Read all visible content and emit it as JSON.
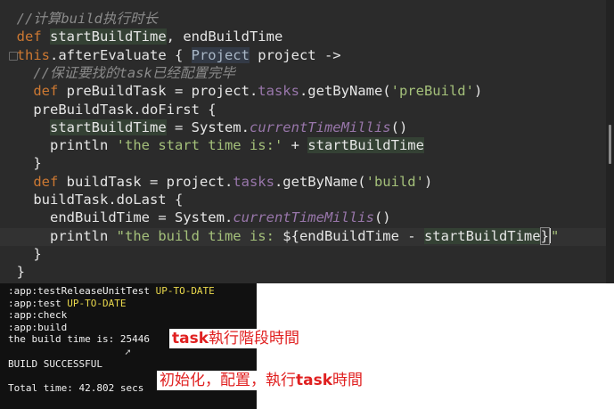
{
  "editor": {
    "lines": [
      {
        "indent": "  ",
        "parts": [
          {
            "t": "//计算build执行时长",
            "c": "cm"
          }
        ]
      },
      {
        "indent": "  ",
        "parts": [
          {
            "t": "def ",
            "c": "kw"
          },
          {
            "t": "startBuildTime",
            "c": "var-hl"
          },
          {
            "t": ", endBuildTime",
            "c": ""
          }
        ]
      },
      {
        "indent": "  ",
        "parts": [
          {
            "t": "this",
            "c": "kw"
          },
          {
            "t": ".afterEvaluate { ",
            "c": ""
          },
          {
            "t": "Project",
            "c": "ty"
          },
          {
            "t": " project ->",
            "c": ""
          }
        ]
      },
      {
        "indent": "    ",
        "parts": [
          {
            "t": "//保证要找的task已经配置完毕",
            "c": "cm"
          }
        ]
      },
      {
        "indent": "    ",
        "parts": [
          {
            "t": "def ",
            "c": "kw"
          },
          {
            "t": "preBuildTask = project.",
            "c": ""
          },
          {
            "t": "tasks",
            "c": "prop"
          },
          {
            "t": ".getByName(",
            "c": ""
          },
          {
            "t": "'preBuild'",
            "c": "str"
          },
          {
            "t": ")",
            "c": ""
          }
        ]
      },
      {
        "indent": "    ",
        "parts": [
          {
            "t": "preBuildTask.doFirst {",
            "c": ""
          }
        ]
      },
      {
        "indent": "      ",
        "parts": [
          {
            "t": "startBuildTime",
            "c": "var-hl"
          },
          {
            "t": " = System.",
            "c": ""
          },
          {
            "t": "currentTimeMillis",
            "c": "stat"
          },
          {
            "t": "()",
            "c": ""
          }
        ]
      },
      {
        "indent": "      ",
        "parts": [
          {
            "t": "println ",
            "c": ""
          },
          {
            "t": "'the start time is:'",
            "c": "str"
          },
          {
            "t": " + ",
            "c": ""
          },
          {
            "t": "startBuildTime",
            "c": "var-hl"
          }
        ]
      },
      {
        "indent": "    ",
        "parts": [
          {
            "t": "}",
            "c": ""
          }
        ]
      },
      {
        "indent": "    ",
        "parts": [
          {
            "t": "def ",
            "c": "kw"
          },
          {
            "t": "buildTask = project.",
            "c": ""
          },
          {
            "t": "tasks",
            "c": "prop"
          },
          {
            "t": ".getByName(",
            "c": ""
          },
          {
            "t": "'build'",
            "c": "str"
          },
          {
            "t": ")",
            "c": ""
          }
        ]
      },
      {
        "indent": "    ",
        "parts": [
          {
            "t": "buildTask.doLast {",
            "c": ""
          }
        ]
      },
      {
        "indent": "      ",
        "parts": [
          {
            "t": "endBuildTime = System.",
            "c": ""
          },
          {
            "t": "currentTimeMillis",
            "c": "stat"
          },
          {
            "t": "()",
            "c": ""
          }
        ]
      },
      {
        "indent": "      ",
        "parts": [
          {
            "t": "println ",
            "c": ""
          },
          {
            "t": "\"the build time is: ",
            "c": "str"
          },
          {
            "t": "${",
            "c": ""
          },
          {
            "t": "endBuildTime - ",
            "c": ""
          },
          {
            "t": "startBuildTime",
            "c": "var-hl"
          },
          {
            "t": "}",
            "c": "brace-hl"
          },
          {
            "t": "\"",
            "c": "str"
          }
        ]
      },
      {
        "indent": "    ",
        "parts": [
          {
            "t": "}",
            "c": ""
          }
        ]
      },
      {
        "indent": "  ",
        "parts": [
          {
            "t": "}",
            "c": ""
          }
        ]
      }
    ]
  },
  "terminal": {
    "lines": [
      {
        "text": ":app:testReleaseUnitTest ",
        "status": "UP-TO-DATE"
      },
      {
        "text": ":app:test ",
        "status": "UP-TO-DATE"
      },
      {
        "text": ":app:check",
        "status": ""
      },
      {
        "text": ":app:build",
        "status": ""
      },
      {
        "text": "the build time is: 25446",
        "status": ""
      },
      {
        "text": "",
        "status": ""
      },
      {
        "text": "BUILD SUCCESSFUL",
        "status": ""
      },
      {
        "text": "",
        "status": ""
      },
      {
        "text": "Total time: 42.802 secs",
        "status": ""
      }
    ]
  },
  "annotations": {
    "note1": {
      "bold": "task",
      "rest": "執行階段時間"
    },
    "note2": {
      "pre": "初始化，配置，執行",
      "bold": "task",
      "post": "時間"
    }
  },
  "colors": {
    "editor_bg": "#2b2b2b",
    "terminal_bg": "#111111",
    "note": "#e02020",
    "up_to_date": "#e9d84c"
  }
}
